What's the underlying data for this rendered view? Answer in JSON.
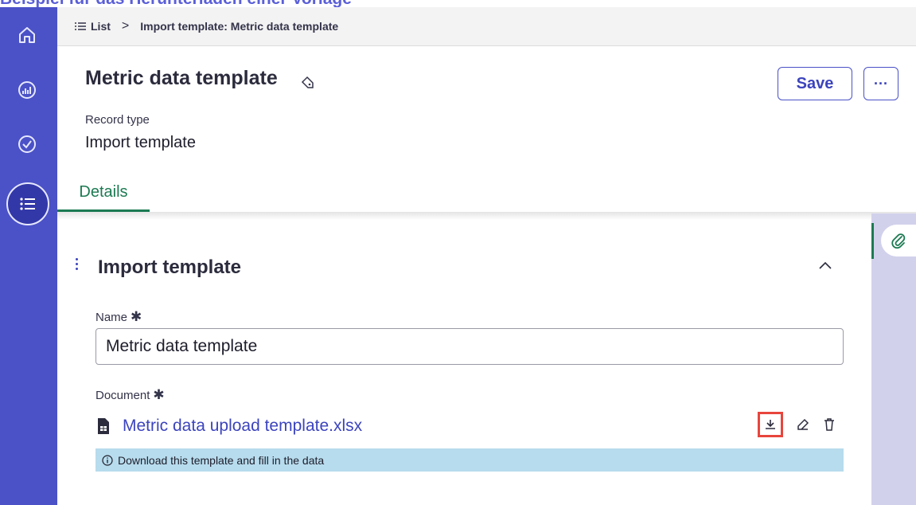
{
  "caption": "Beispiel für das Herunterladen einer Vorlage",
  "breadcrumb": {
    "list_label": "List",
    "separator": ">",
    "current": "Import template: Metric data template"
  },
  "rail": {
    "items": [
      "home-icon",
      "dashboard-icon",
      "check-circle-icon",
      "list-icon"
    ],
    "active": "list-icon"
  },
  "header": {
    "title": "Metric data template",
    "save_label": "Save",
    "more_label": "···",
    "record_type_label": "Record type",
    "record_type_value": "Import template"
  },
  "tabs": [
    {
      "label": "Details",
      "active": true
    }
  ],
  "section": {
    "title": "Import template",
    "name_label": "Name",
    "name_value": "Metric data template",
    "document_label": "Document",
    "document_name": "Metric data upload template.xlsx",
    "info_text": "Download this template and fill in the data"
  },
  "colors": {
    "rail": "#4b52c7",
    "accent": "#3c44bd",
    "tab_active": "#1c7a52",
    "info_bg": "#b7dced",
    "highlight": "#e8453c",
    "side_panel": "#d2d1ec"
  }
}
